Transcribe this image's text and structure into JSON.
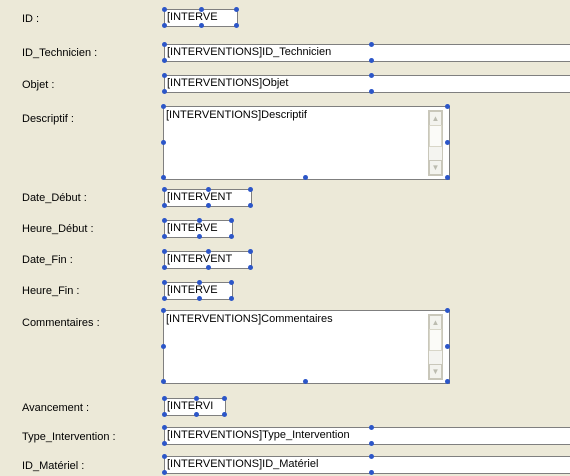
{
  "form": {
    "fields": [
      {
        "label": "ID :",
        "value": "[INTERVE"
      },
      {
        "label": "ID_Technicien :",
        "value": "[INTERVENTIONS]ID_Technicien"
      },
      {
        "label": "Objet :",
        "value": "[INTERVENTIONS]Objet"
      },
      {
        "label": "Descriptif :",
        "value": "[INTERVENTIONS]Descriptif"
      },
      {
        "label": "Date_Début :",
        "value": "[INTERVENT"
      },
      {
        "label": "Heure_Début :",
        "value": "[INTERVE"
      },
      {
        "label": "Date_Fin :",
        "value": "[INTERVENT"
      },
      {
        "label": "Heure_Fin :",
        "value": "[INTERVE"
      },
      {
        "label": "Commentaires :",
        "value": "[INTERVENTIONS]Commentaires"
      },
      {
        "label": "Avancement :",
        "value": "[INTERVI"
      },
      {
        "label": "Type_Intervention :",
        "value": "[INTERVENTIONS]Type_Intervention"
      },
      {
        "label": "ID_Matériel :",
        "value": "[INTERVENTIONS]ID_Matériel"
      }
    ],
    "scroll_up_glyph": "▲",
    "scroll_down_glyph": "▼"
  },
  "colors": {
    "background": "#ece9d8",
    "selection_handle": "#2c56c8",
    "field_border": "#7f7f7f"
  }
}
